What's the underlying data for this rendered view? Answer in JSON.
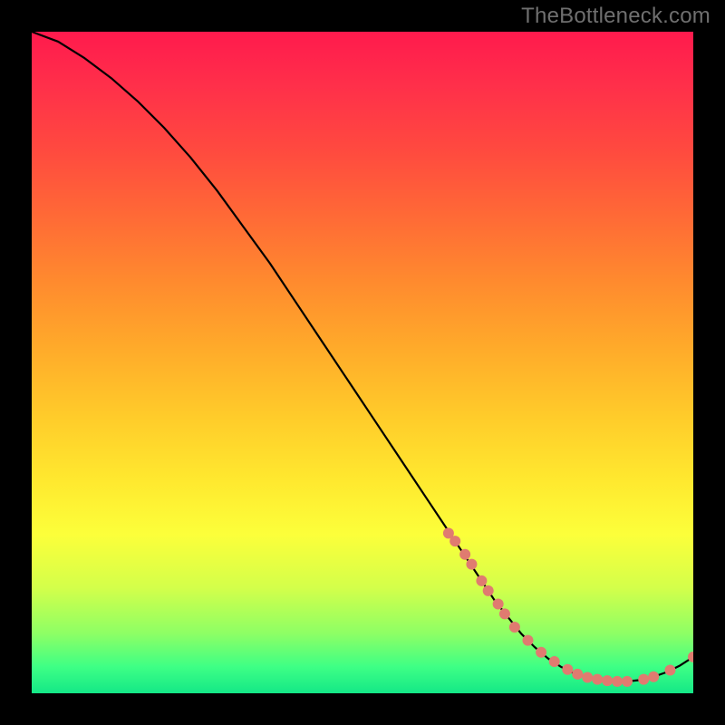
{
  "watermark": "TheBottleneck.com",
  "chart_data": {
    "type": "line",
    "title": "",
    "xlabel": "",
    "ylabel": "",
    "xlim": [
      0,
      100
    ],
    "ylim": [
      0,
      100
    ],
    "grid": false,
    "legend": false,
    "background": "rainbow-vertical-red-to-green",
    "series": [
      {
        "name": "bottleneck-curve",
        "color": "#000000",
        "x": [
          0,
          4,
          8,
          12,
          16,
          20,
          24,
          28,
          32,
          36,
          40,
          44,
          48,
          52,
          56,
          60,
          64,
          66,
          68,
          70,
          72,
          74,
          76,
          78,
          80,
          82,
          84,
          86,
          88,
          90,
          92,
          94,
          96,
          98,
          100
        ],
        "y": [
          100,
          98.5,
          96,
          93,
          89.5,
          85.5,
          81,
          76,
          70.5,
          65,
          59,
          53,
          47,
          41,
          35,
          29,
          23,
          20,
          17,
          14,
          11.5,
          9,
          7,
          5.3,
          4,
          3,
          2.4,
          2,
          1.8,
          1.8,
          2,
          2.5,
          3.2,
          4.2,
          5.5
        ]
      }
    ],
    "markers": {
      "name": "bottleneck-dots",
      "color": "#e07b70",
      "radius": 6,
      "points": [
        {
          "x": 63,
          "y": 24.2
        },
        {
          "x": 64,
          "y": 23
        },
        {
          "x": 65.5,
          "y": 21
        },
        {
          "x": 66.5,
          "y": 19.5
        },
        {
          "x": 68,
          "y": 17
        },
        {
          "x": 69,
          "y": 15.5
        },
        {
          "x": 70.5,
          "y": 13.5
        },
        {
          "x": 71.5,
          "y": 12
        },
        {
          "x": 73,
          "y": 10
        },
        {
          "x": 75,
          "y": 8
        },
        {
          "x": 77,
          "y": 6.2
        },
        {
          "x": 79,
          "y": 4.8
        },
        {
          "x": 81,
          "y": 3.6
        },
        {
          "x": 82.5,
          "y": 2.9
        },
        {
          "x": 84,
          "y": 2.4
        },
        {
          "x": 85.5,
          "y": 2.1
        },
        {
          "x": 87,
          "y": 1.9
        },
        {
          "x": 88.5,
          "y": 1.8
        },
        {
          "x": 90,
          "y": 1.8
        },
        {
          "x": 92.5,
          "y": 2.1
        },
        {
          "x": 94,
          "y": 2.5
        },
        {
          "x": 96.5,
          "y": 3.5
        },
        {
          "x": 100,
          "y": 5.5
        }
      ]
    }
  }
}
